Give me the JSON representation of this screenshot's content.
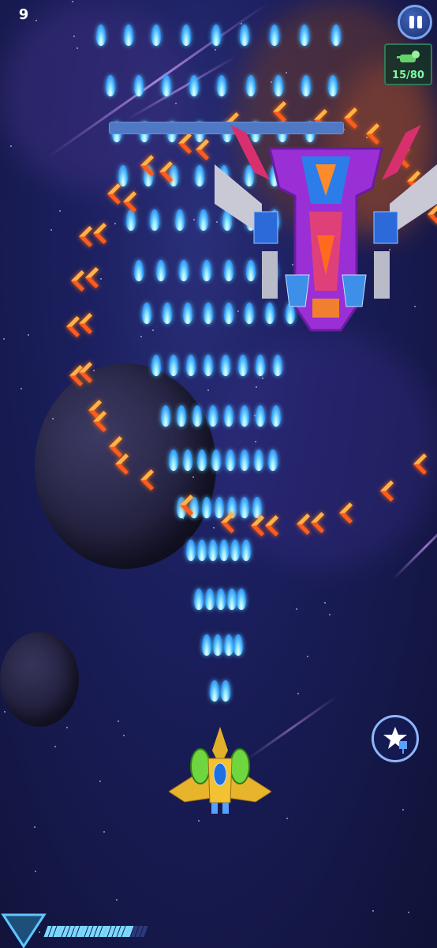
{
  "hud": {
    "kill_counter": "15/80",
    "level": "9",
    "power_level": 0.86
  },
  "icons": {
    "pause": "pause-icon",
    "kills": "drone-kill-icon",
    "skill": "special-attack-icon"
  },
  "colors": {
    "player_bullet": "#4ec4ff",
    "enemy_shot": "#ff6a00",
    "boss_primary": "#9b2fd6",
    "boss_health": "#4f79c4",
    "kill_text": "#7dffa7"
  },
  "boss": {
    "health_fraction": 1.0
  }
}
